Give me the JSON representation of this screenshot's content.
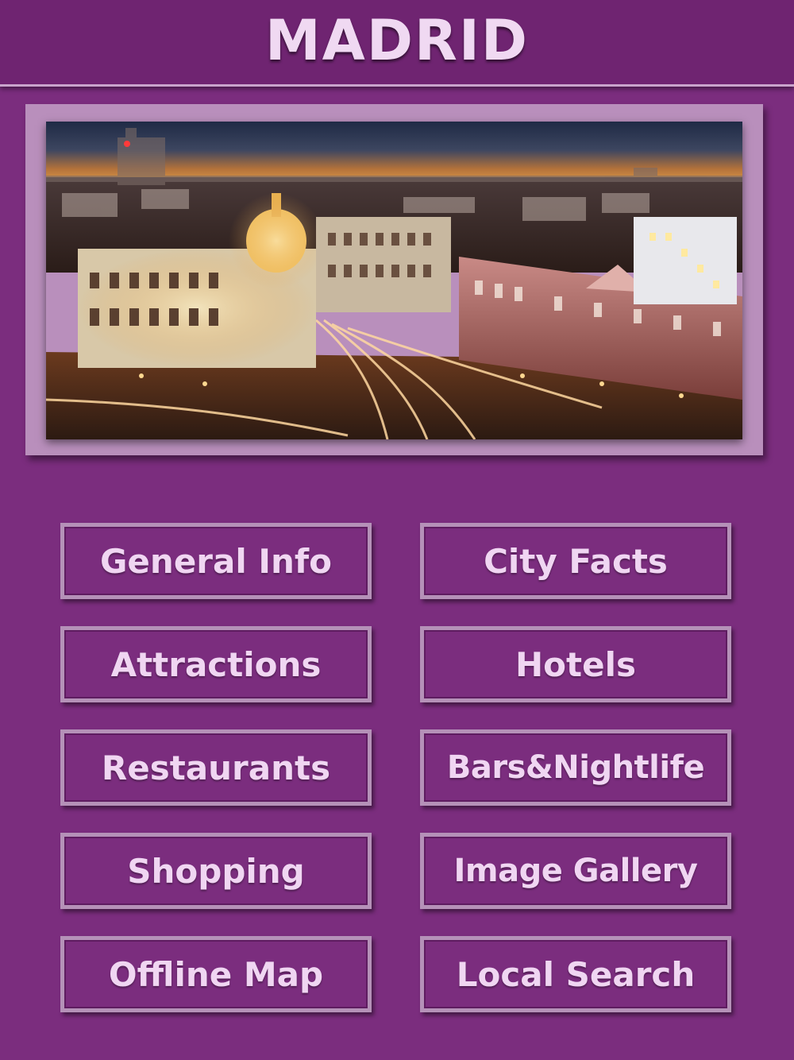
{
  "header": {
    "title": "MADRID"
  },
  "hero": {
    "image_subject": "madrid-city-night-panorama-photo"
  },
  "menu": {
    "general_info": "General Info",
    "city_facts": "City Facts",
    "attractions": "Attractions",
    "hotels": "Hotels",
    "restaurants": "Restaurants",
    "bars_nightlife": "Bars&Nightlife",
    "shopping": "Shopping",
    "image_gallery": "Image Gallery",
    "offline_map": "Offline Map",
    "local_search": "Local Search"
  },
  "colors": {
    "background": "#7b2d7e",
    "header": "#6f2471",
    "button_border": "#b591b8",
    "text": "#f0d6f2"
  }
}
